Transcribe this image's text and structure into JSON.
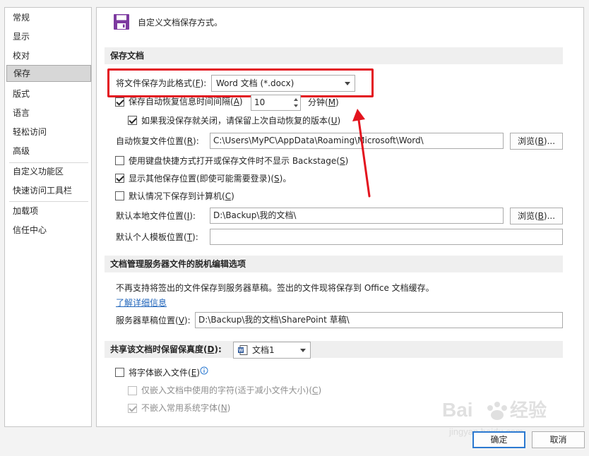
{
  "sidebar": {
    "items": [
      {
        "label": "常规"
      },
      {
        "label": "显示"
      },
      {
        "label": "校对"
      },
      {
        "label": "保存"
      },
      {
        "label": "版式"
      },
      {
        "label": "语言"
      },
      {
        "label": "轻松访问"
      },
      {
        "label": "高级"
      },
      {
        "label": "自定义功能区"
      },
      {
        "label": "快速访问工具栏"
      },
      {
        "label": "加载项"
      },
      {
        "label": "信任中心"
      }
    ],
    "selected": "保存"
  },
  "header": {
    "text": "自定义文档保存方式。",
    "icon": "save-disk-icon"
  },
  "save_section": {
    "title": "保存文档",
    "format_label": "将文件保存为此格式(",
    "format_key": "F",
    "format_label_end": "):",
    "format_value": "Word 文档 (*.docx)",
    "autorecover": {
      "label": "保存自动恢复信息时间间隔(",
      "key": "A",
      "label_end": ")",
      "checked": true,
      "minutes": "10",
      "unit": "分钟(",
      "unit_key": "M",
      "unit_end": ")"
    },
    "keep_last": {
      "label": "如果我没保存就关闭，请保留上次自动恢复的版本(",
      "key": "U",
      "label_end": ")",
      "checked": true
    },
    "autorecover_location": {
      "label": "自动恢复文件位置(",
      "key": "R",
      "label_end": "):",
      "value": "C:\\Users\\MyPC\\AppData\\Roaming\\Microsoft\\Word\\",
      "browse": "浏览(",
      "browse_key": "B",
      "browse_end": ")..."
    },
    "no_backstage": {
      "label": "使用键盘快捷方式打开或保存文件时不显示 Backstage(",
      "key": "S",
      "label_end": ")",
      "checked": false
    },
    "show_other": {
      "label": "显示其他保存位置(即使可能需要登录)(",
      "key": "S",
      "label_end": ")。",
      "checked": true
    },
    "save_to_computer": {
      "label": "默认情况下保存到计算机(",
      "key": "C",
      "label_end": ")",
      "checked": false
    },
    "local_location": {
      "label": "默认本地文件位置(",
      "key": "I",
      "label_end": "):",
      "value": "D:\\Backup\\我的文档\\",
      "browse": "浏览(",
      "browse_key": "B",
      "browse_end": ")..."
    },
    "template_location": {
      "label": "默认个人模板位置(",
      "key": "T",
      "label_end": "):",
      "value": ""
    }
  },
  "offline_section": {
    "title": "文档管理服务器文件的脱机编辑选项",
    "description": "不再支持将签出的文件保存到服务器草稿。签出的文件现将保存到 Office 文档缓存。",
    "learn_more": "了解详细信息",
    "drafts_label": "服务器草稿位置(",
    "drafts_key": "V",
    "drafts_label_end": "):",
    "drafts_value": "D:\\Backup\\我的文档\\SharePoint 草稿\\"
  },
  "fidelity_section": {
    "title": "共享该文档时保留保真度(",
    "title_key": "D",
    "title_end": "):",
    "document": "文档1",
    "embed_fonts": {
      "label": "将字体嵌入文件(",
      "key": "E",
      "label_end": ")",
      "checked": false,
      "info_icon": "info-icon"
    },
    "embed_used_chars": {
      "label": "仅嵌入文档中使用的字符(适于减小文件大小)(",
      "key": "C",
      "label_end": ")",
      "checked": false,
      "disabled": true
    },
    "no_common_fonts": {
      "label": "不嵌入常用系统字体(",
      "key": "N",
      "label_end": ")",
      "checked": true,
      "disabled": true
    }
  },
  "footer": {
    "ok": "确定",
    "cancel": "取消"
  },
  "colors": {
    "highlight_box": "#e3141e",
    "arrow": "#e3141e",
    "link": "#2266bb",
    "primary_button_border": "#2b79d0"
  }
}
